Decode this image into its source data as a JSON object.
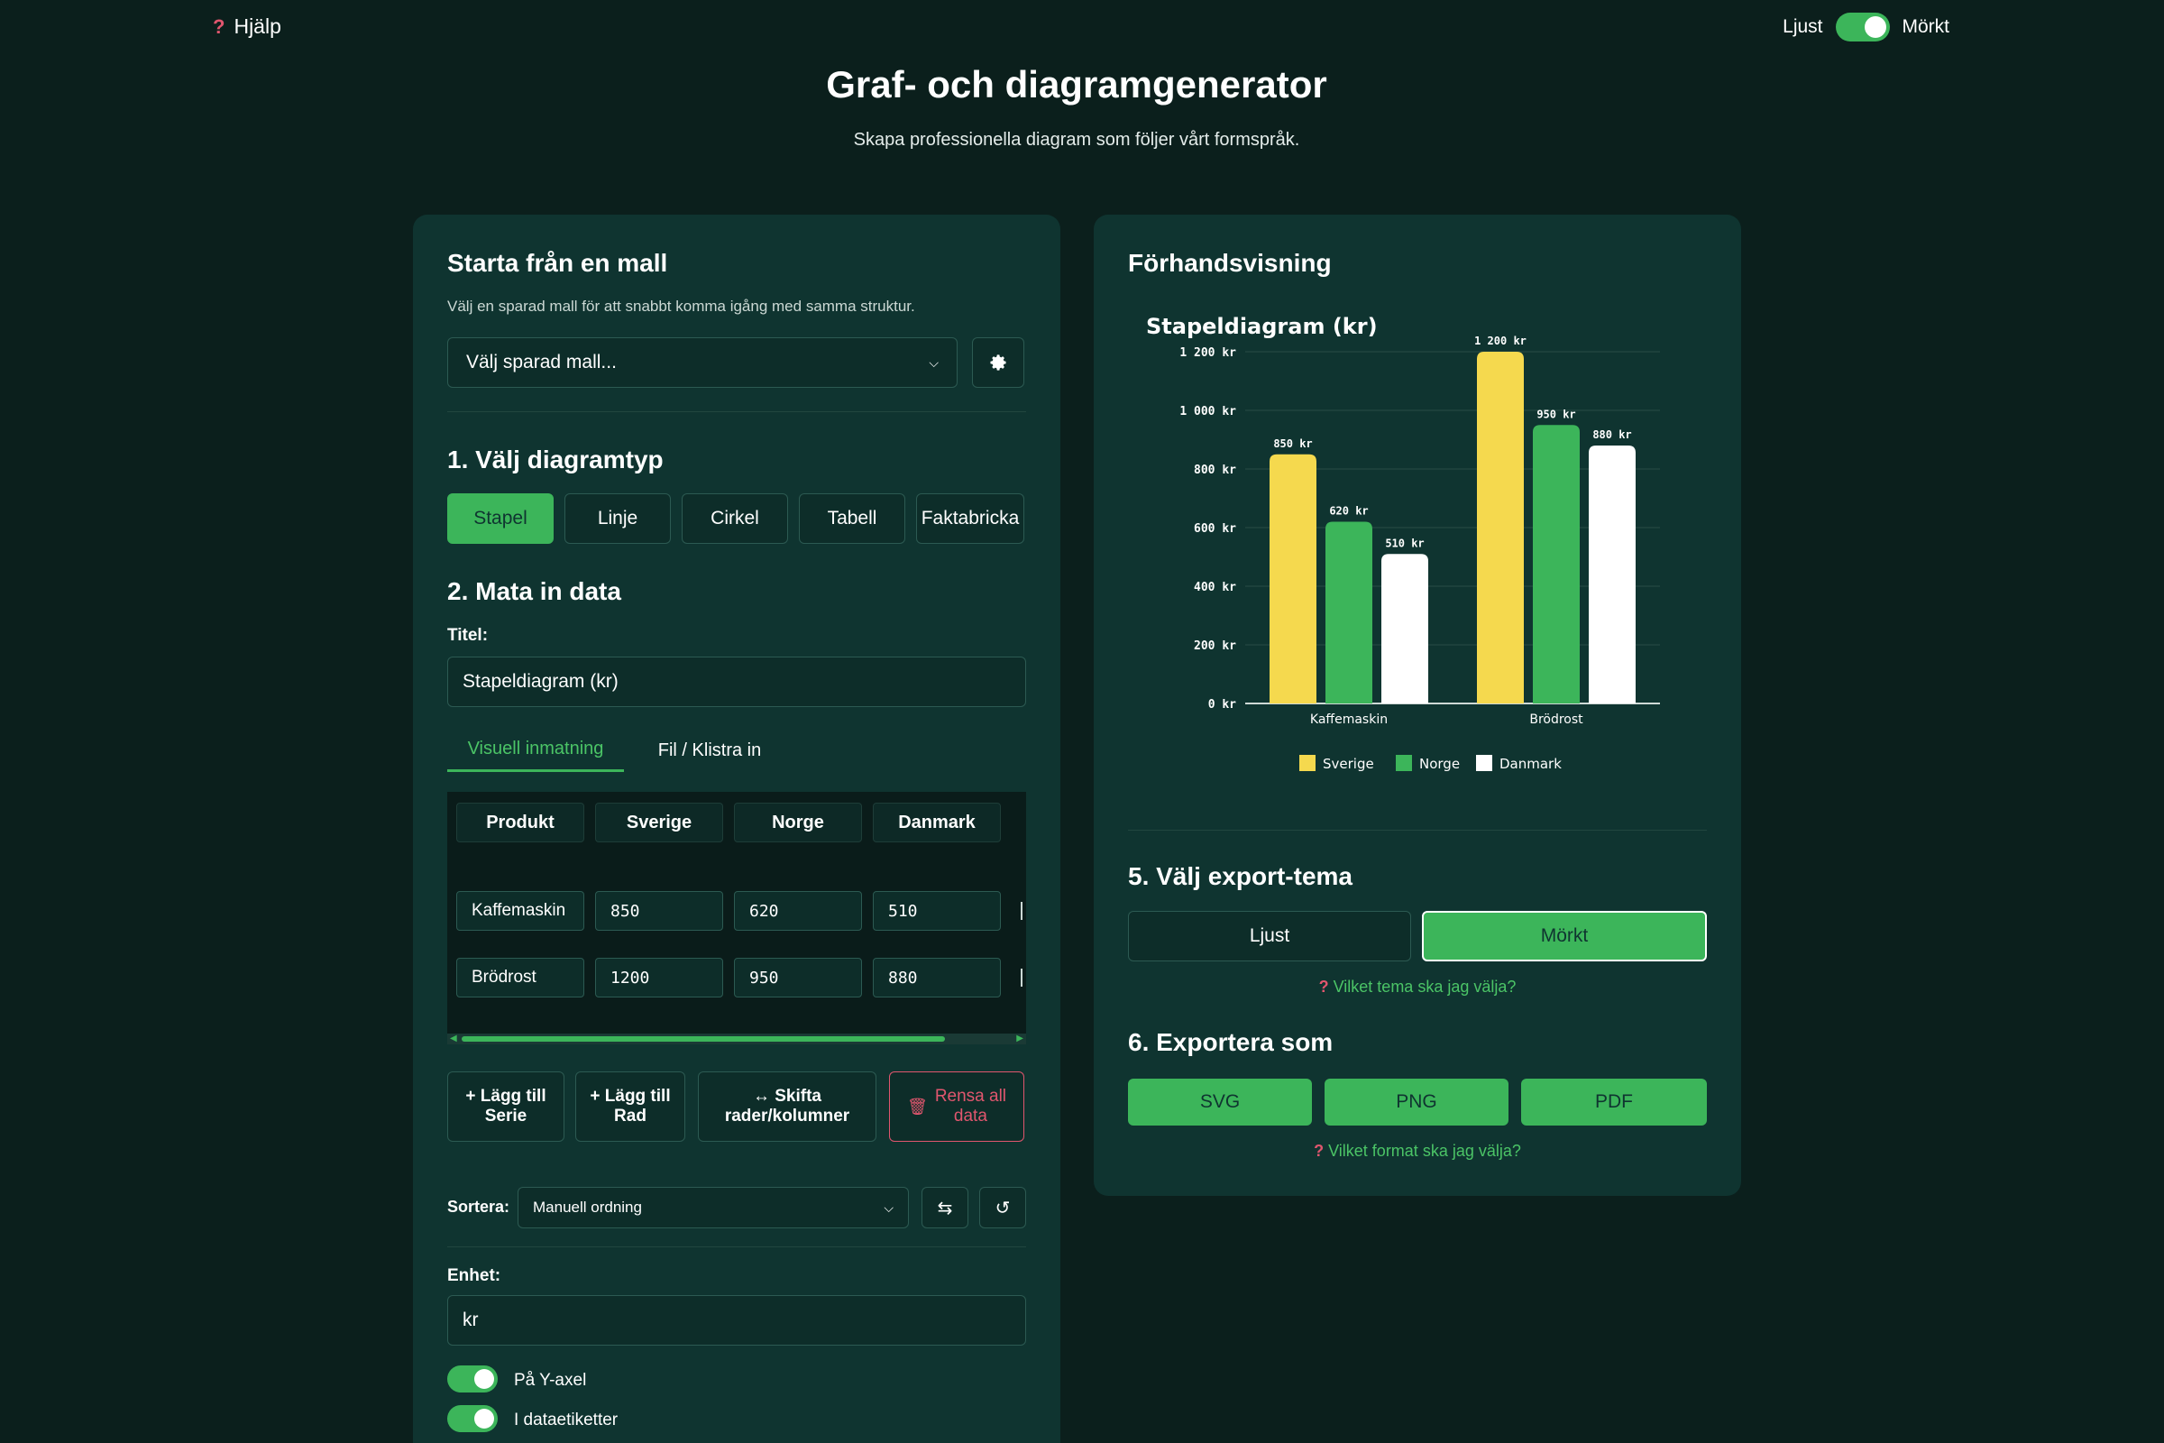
{
  "header": {
    "help_label": "Hjälp",
    "help_icon": "question-mark-icon",
    "theme_light_label": "Ljust",
    "theme_dark_label": "Mörkt",
    "title": "Graf- och diagramgenerator",
    "subtitle": "Skapa professionella diagram som följer vårt formspråk."
  },
  "colors": {
    "background": "#0b1f1c",
    "panel": "#0f3430",
    "accent": "#3cb55a",
    "danger": "#e0566e",
    "series_sverige": "#f5d94e",
    "series_norge": "#3cb55a",
    "series_danmark": "#ffffff"
  },
  "template_section": {
    "heading": "Starta från en mall",
    "description": "Välj en sparad mall för att snabbt komma igång med samma struktur.",
    "select_value": "Välj sparad mall...",
    "settings_icon": "gear-icon"
  },
  "chart_type": {
    "heading": "1. Välj diagramtyp",
    "options": [
      "Stapel",
      "Linje",
      "Cirkel",
      "Tabell",
      "Faktabricka"
    ],
    "selected": "Stapel"
  },
  "data_section": {
    "heading": "2. Mata in data",
    "title_label": "Titel:",
    "title_value": "Stapeldiagram (kr)",
    "tabs": [
      "Visuell inmatning",
      "Fil / Klistra in"
    ],
    "active_tab": "Visuell inmatning",
    "columns": [
      "Produkt",
      "Sverige",
      "Norge",
      "Danmark"
    ],
    "rows": [
      [
        "Kaffemaskin",
        "850",
        "620",
        "510"
      ],
      [
        "Brödrost",
        "1200",
        "950",
        "880"
      ]
    ],
    "buttons": {
      "add_series": "+ Lägg till\nSerie",
      "add_row": "+ Lägg till\nRad",
      "swap": "↔ Skifta\nrader/kolumner",
      "clear": "Rensa all\ndata"
    },
    "sort_label": "Sortera:",
    "sort_value": "Manuell ordning",
    "unit_label": "Enhet:",
    "unit_value": "kr",
    "toggle_y_axis": "På Y-axel",
    "toggle_data_labels": "I dataetiketter"
  },
  "preview": {
    "heading": "Förhandsvisning"
  },
  "chart_data": {
    "type": "bar",
    "title": "Stapeldiagram (kr)",
    "categories": [
      "Kaffemaskin",
      "Brödrost"
    ],
    "series": [
      {
        "name": "Sverige",
        "values": [
          850,
          1200
        ],
        "labels": [
          "850 kr",
          "1 200 kr"
        ]
      },
      {
        "name": "Norge",
        "values": [
          620,
          950
        ],
        "labels": [
          "620 kr",
          "950 kr"
        ]
      },
      {
        "name": "Danmark",
        "values": [
          510,
          880
        ],
        "labels": [
          "510 kr",
          "880 kr"
        ]
      }
    ],
    "ylim": [
      0,
      1200
    ],
    "yticks": [
      0,
      200,
      400,
      600,
      800,
      1000,
      1200
    ],
    "ytick_labels": [
      "0 kr",
      "200 kr",
      "400 kr",
      "600 kr",
      "800 kr",
      "1 000 kr",
      "1 200 kr"
    ],
    "grid": true,
    "legend": "bottom"
  },
  "export_theme": {
    "heading": "5. Välj export-tema",
    "options": [
      "Ljust",
      "Mörkt"
    ],
    "selected": "Mörkt",
    "help": "Vilket tema ska jag välja?"
  },
  "export_as": {
    "heading": "6. Exportera som",
    "formats": [
      "SVG",
      "PNG",
      "PDF"
    ],
    "help": "Vilket format ska jag välja?"
  }
}
